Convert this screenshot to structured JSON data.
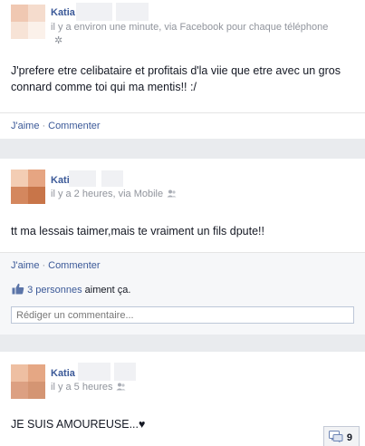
{
  "posts": [
    {
      "author": "Katia",
      "timestamp": "il y a environ une minute, via Facebook pour chaque téléphone",
      "text": "J'prefere etre celibataire et profitais d'la viie que etre avec un gros connard comme toi qui ma mentis!! :/",
      "actions": {
        "like": "J'aime",
        "sep": "·",
        "comment": "Commenter"
      }
    },
    {
      "author": "Kati",
      "timestamp": "il y a 2 heures, via Mobile",
      "text": "tt ma lessais taimer,mais te vraiment un fils dpute!!",
      "actions": {
        "like": "J'aime",
        "sep": "·",
        "comment": "Commenter"
      },
      "likes": {
        "count_link": "3 personnes",
        "suffix": "aiment ça."
      },
      "comment_placeholder": "Rédiger un commentaire..."
    },
    {
      "author": "Katia",
      "timestamp": "il y a 5 heures",
      "text": "JE SUIS AMOUREUSE...♥"
    }
  ],
  "chat": {
    "count": "9"
  },
  "colors": {
    "link": "#3b5998",
    "meta": "#90949c",
    "background": "#e9ebee"
  },
  "icons": [
    "gear-icon",
    "friends-audience-icon",
    "like-thumb-icon",
    "chat-icon"
  ]
}
